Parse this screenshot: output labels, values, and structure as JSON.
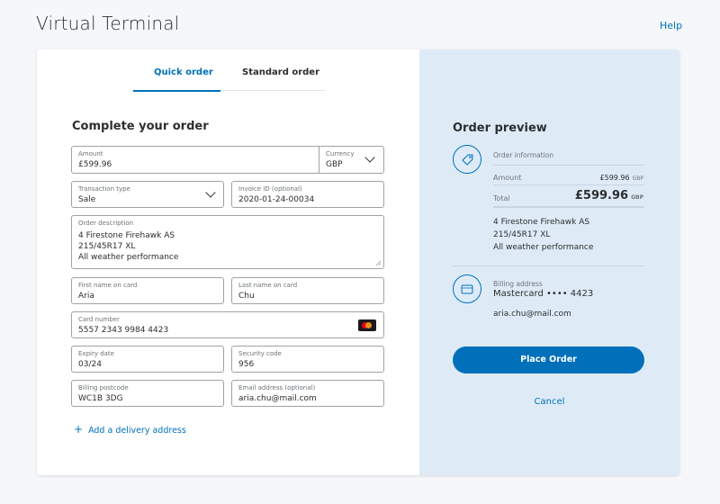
{
  "header": {
    "title": "Virtual Terminal",
    "help_label": "Help"
  },
  "tabs": {
    "quick_order": "Quick order",
    "standard_order": "Standard order",
    "active": "quick_order"
  },
  "form": {
    "section_title": "Complete your order",
    "amount": {
      "label": "Amount",
      "value": "£599.96"
    },
    "currency": {
      "label": "Currency",
      "value": "GBP"
    },
    "transaction_type": {
      "label": "Transaction type",
      "value": "Sale"
    },
    "invoice_id": {
      "label": "Invoice ID (optional)",
      "value": "2020-01-24-00034"
    },
    "order_description": {
      "label": "Order description",
      "lines": [
        "4 Firestone Firehawk AS",
        "215/45R17 XL",
        "All weather performance"
      ]
    },
    "first_name": {
      "label": "First name on card",
      "value": "Aria"
    },
    "last_name": {
      "label": "Last name on card",
      "value": "Chu"
    },
    "card_number": {
      "label": "Card number",
      "value": "5557 2343 9984 4423"
    },
    "expiry_date": {
      "label": "Expiry date",
      "value": "03/24"
    },
    "security_code": {
      "label": "Security code",
      "value": "956"
    },
    "billing_postcode": {
      "label": "Billing postcode",
      "value": "WC1B 3DG"
    },
    "email": {
      "label": "Email address (optional)",
      "value": "aria.chu@mail.com"
    },
    "add_delivery_label": "Add a delivery address"
  },
  "preview": {
    "title": "Order preview",
    "order_info_label": "Order information",
    "amount_label": "Amount",
    "amount_value": "£599.96",
    "amount_currency": "GBP",
    "total_label": "Total",
    "total_value": "£599.96",
    "total_currency": "GBP",
    "description_lines": [
      "4 Firestone Firehawk AS",
      "215/45R17 XL",
      "All weather performance"
    ],
    "billing_label": "Billing address",
    "card_summary": "Mastercard •••• 4423",
    "email": "aria.chu@mail.com",
    "place_order_label": "Place Order",
    "cancel_label": "Cancel"
  },
  "colors": {
    "accent": "#0070ba",
    "preview_bg": "#deebf7",
    "mastercard_red": "#eb001b",
    "mastercard_orange": "#f79e1b"
  },
  "icons": {
    "tag": "tag-icon",
    "card": "credit-card-icon",
    "chevron": "chevron-down-icon",
    "mastercard": "mastercard-icon",
    "plus": "plus-icon"
  }
}
